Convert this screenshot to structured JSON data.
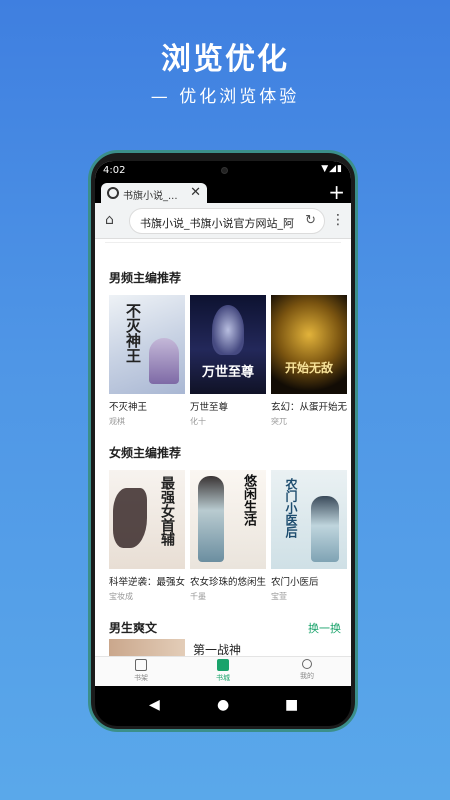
{
  "promo": {
    "title": "浏览优化",
    "subtitle": "— 优化浏览体验"
  },
  "status": {
    "time": "4:02",
    "icons": "▼◢▮"
  },
  "tab": {
    "title": "书旗小说_...",
    "close": "✕",
    "new_tab": "+"
  },
  "toolbar": {
    "home": "⌂",
    "url": "书旗小说_书旗小说官方网站_阿",
    "reload": "↻",
    "menu": "⋮"
  },
  "sections": [
    {
      "title": "男频主编推荐",
      "books": [
        {
          "name": "不灭神王",
          "author": "观棋",
          "cover_text": "不灭神王"
        },
        {
          "name": "万世至尊",
          "author": "化十",
          "cover_text": "万世至尊"
        },
        {
          "name": "玄幻：从蛋开始无...",
          "author": "突兀",
          "cover_text": "开始无敌"
        }
      ]
    },
    {
      "title": "女频主编推荐",
      "books": [
        {
          "name": "科举逆袭：最强女...",
          "author": "宝妆成",
          "cover_text": "最强女首辅"
        },
        {
          "name": "农女珍珠的悠闲生...",
          "author": "千墨",
          "cover_text": "悠闲生活"
        },
        {
          "name": "农门小医后",
          "author": "宝萱",
          "cover_text": "农门小医后"
        }
      ]
    },
    {
      "title": "男生爽文",
      "more": "换一换",
      "first_item": "第一战神"
    }
  ],
  "nav": [
    {
      "label": "书架",
      "icon": "bookshelf-icon",
      "active": false
    },
    {
      "label": "书城",
      "icon": "bookstore-icon",
      "active": true
    },
    {
      "label": "我的",
      "icon": "person-icon",
      "active": false
    }
  ],
  "sysnav": {
    "back": "◀",
    "home": "●",
    "recents": "■"
  },
  "colors": {
    "accent": "#1aa36b",
    "background_top": "#3f7fe0",
    "background_bottom": "#5aa8ea"
  }
}
